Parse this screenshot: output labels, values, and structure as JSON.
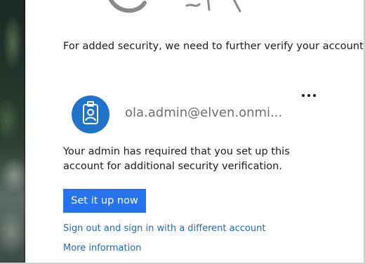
{
  "heading": "For added security, we need to further verify your account",
  "account": {
    "email": "ola.admin@elven.onmi...",
    "avatar_icon": "badge-icon",
    "more_icon": "more-options-icon"
  },
  "message": "Your admin has required that you set up this account for additional security verification.",
  "actions": {
    "primary_label": "Set it up now",
    "signout_link": "Sign out and sign in with a different account",
    "more_info_link": "More information"
  },
  "colors": {
    "primary": "#2672ec",
    "link": "#1f66c2",
    "avatar": "#1f73c9"
  }
}
